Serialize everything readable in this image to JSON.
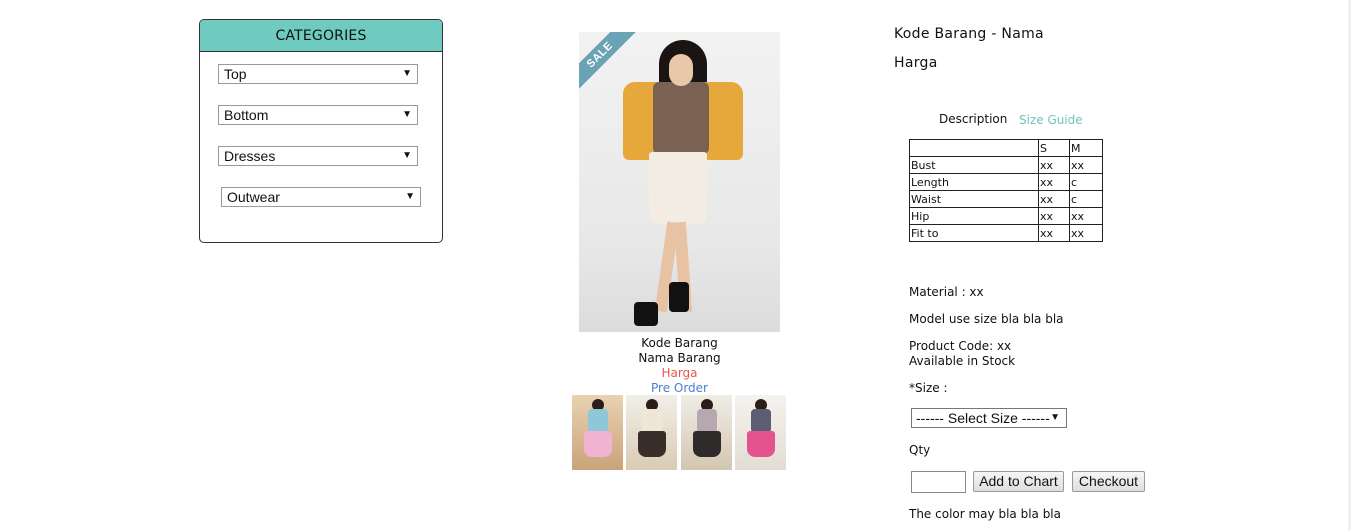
{
  "categories": {
    "title": "CATEGORIES",
    "items": [
      {
        "label": "Top"
      },
      {
        "label": "Bottom"
      },
      {
        "label": "Dresses"
      },
      {
        "label": "Outwear"
      }
    ]
  },
  "product": {
    "sale_badge": "SALE",
    "caption_code": "Kode Barang",
    "caption_name": "Nama Barang",
    "caption_price": "Harga",
    "caption_preorder": "Pre Order",
    "title": "Kode Barang - Nama",
    "price": "Harga"
  },
  "tabs": {
    "description": "Description",
    "size_guide": "Size Guide"
  },
  "size_table": {
    "headers": [
      "",
      "S",
      "M"
    ],
    "rows": [
      [
        "Bust",
        "xx",
        "xx"
      ],
      [
        "Length",
        "xx",
        "c"
      ],
      [
        "Waist",
        "xx",
        "c"
      ],
      [
        "Hip",
        "xx",
        "xx"
      ],
      [
        "Fit to",
        "xx",
        "xx"
      ]
    ]
  },
  "details": {
    "material": "Material : xx",
    "model_size": "Model use size bla bla bla",
    "product_code": "Product Code: xx",
    "stock": "Available in Stock",
    "size_label": "*Size :",
    "size_select": "------ Select Size ------",
    "qty_label": "Qty",
    "qty_value": "",
    "add_to_chart": "Add to Chart",
    "checkout": "Checkout",
    "color_note": "The color may bla bla bla"
  },
  "colors": {
    "accent": "#6fcabf",
    "price": "#e8584f",
    "preorder": "#4a7fcf"
  }
}
